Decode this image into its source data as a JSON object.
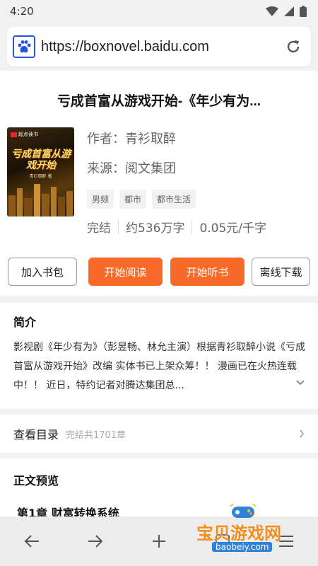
{
  "status_bar": {
    "time": "4:20"
  },
  "browser": {
    "url": "https://boxnovel.baidu.com"
  },
  "book": {
    "title": "亏成首富从游戏开始-《年少有为...",
    "author": "作者：青衫取醉",
    "source": "来源：阅文集团",
    "tags": [
      "男频",
      "都市",
      "都市生活"
    ],
    "status": "完结",
    "word_count": "约536万字",
    "price": "0.05元/千字",
    "cover": {
      "badge": "起点读书",
      "title": "亏成首富从游戏开始",
      "subtitle": "青衫取醉 著"
    }
  },
  "actions": {
    "add_shelf": "加入书包",
    "start_read": "开始阅读",
    "start_listen": "开始听书",
    "offline_download": "离线下载"
  },
  "intro": {
    "title": "简介",
    "text": "影视剧《年少有为》（彭昱畅、林允主演）根据青衫取醉小说《亏成首富从游戏开始》改编 实体书已上架众筹！！ 漫画已在火热连载中！！ 近日，特约记者对腾达集团总..."
  },
  "toc": {
    "label": "查看目录",
    "sub": "完结共1701章"
  },
  "preview": {
    "title": "正文预览",
    "chapter": "第1章 财富转换系统"
  },
  "watermark": {
    "text": "宝贝游戏网",
    "url": "baobeiy.com"
  },
  "colors": {
    "accent": "#f86a2a",
    "link_blue": "#2852e0"
  }
}
